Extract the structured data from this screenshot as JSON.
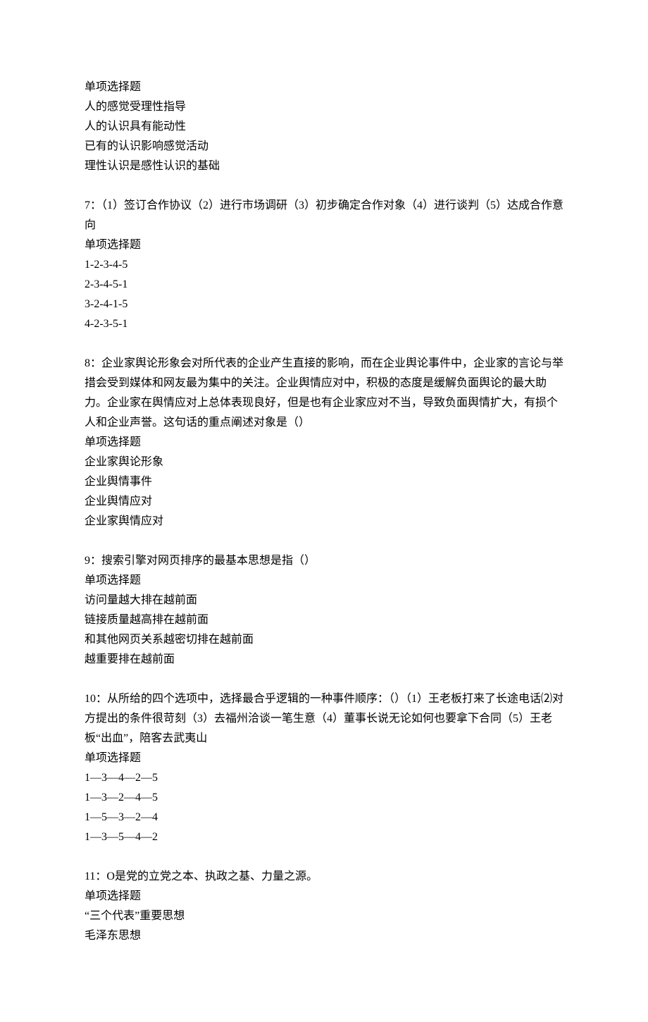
{
  "q6_partial": {
    "type": "单项选择题",
    "options": [
      "人的感觉受理性指导",
      "人的认识具有能动性",
      "已有的认识影响感觉活动",
      "理性认识是感性认识的基础"
    ]
  },
  "q7": {
    "stem": "7：（1）签订合作协议（2）进行市场调研（3）初步确定合作对象（4）进行谈判（5）达成合作意向",
    "type": "单项选择题",
    "options": [
      "1-2-3-4-5",
      "2-3-4-5-1",
      "3-2-4-1-5",
      "4-2-3-5-1"
    ]
  },
  "q8": {
    "stem": "8：企业家舆论形象会对所代表的企业产生直接的影响，而在企业舆论事件中，企业家的言论与举措会受到媒体和网友最为集中的关注。企业舆情应对中，积极的态度是缓解负面舆论的最大助力。企业家在舆情应对上总体表现良好，但是也有企业家应对不当，导致负面舆情扩大，有损个人和企业声誉。这句话的重点阐述对象是（）",
    "type": "单项选择题",
    "options": [
      "企业家舆论形象",
      "企业舆情事件",
      "企业舆情应对",
      "企业家舆情应对"
    ]
  },
  "q9": {
    "stem": "9：搜索引擎对网页排序的最基本思想是指（）",
    "type": "单项选择题",
    "options": [
      "访问量越大排在越前面",
      "链接质量越高排在越前面",
      "和其他网页关系越密切排在越前面",
      "越重要排在越前面"
    ]
  },
  "q10": {
    "stem": "10：从所给的四个选项中，选择最合乎逻辑的一种事件顺序：（）（1）王老板打来了长途电话⑵对方提出的条件很苛刻（3）去福州洽谈一笔生意（4）董事长说无论如何也要拿下合同（5）王老板“出血”，陪客去武夷山",
    "type": "单项选择题",
    "options": [
      "1—3—4—2—5",
      "1—3—2—4—5",
      "1—5—3—2—4",
      "1—3—5—4—2"
    ]
  },
  "q11": {
    "stem": "11：O是党的立党之本、执政之基、力量之源。",
    "type": "单项选择题",
    "options": [
      "“三个代表”重要思想",
      "毛泽东思想"
    ]
  }
}
